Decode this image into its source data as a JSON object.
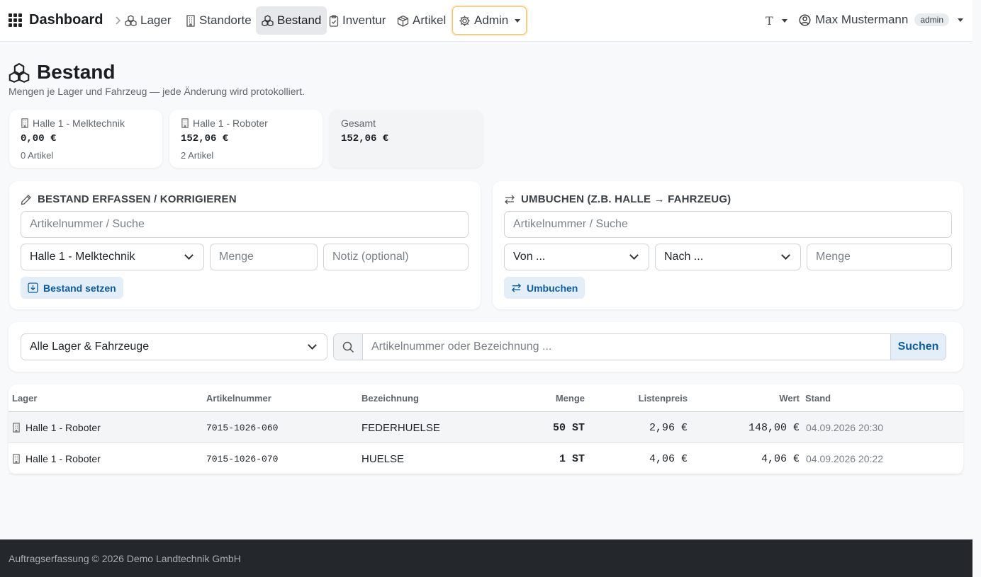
{
  "nav": {
    "brand": "Dashboard",
    "items": [
      {
        "label": "Lager",
        "icon": "boxes-icon"
      },
      {
        "label": "Standorte",
        "icon": "building-icon"
      },
      {
        "label": "Bestand",
        "icon": "boxes-icon",
        "active": true
      },
      {
        "label": "Inventur",
        "icon": "clipboard-check-icon"
      },
      {
        "label": "Artikel",
        "icon": "box-icon"
      },
      {
        "label": "Admin",
        "icon": "gear-icon"
      }
    ],
    "theme_label": "T",
    "user_name": "Max Mustermann",
    "user_role": "admin"
  },
  "page": {
    "title": "Bestand",
    "subtitle": "Mengen je Lager und Fahrzeug — jede Änderung wird protokolliert."
  },
  "summary": [
    {
      "name": "Halle 1 - Melktechnik",
      "value": "0,00 €",
      "count": "0 Artikel"
    },
    {
      "name": "Halle 1 - Roboter",
      "value": "152,06 €",
      "count": "2 Artikel"
    },
    {
      "name": "Gesamt",
      "value": "152,06 €"
    }
  ],
  "stock_form": {
    "title": "BESTAND ERFASSEN / KORRIGIEREN",
    "article_placeholder": "Artikelnummer / Suche",
    "location_value": "Halle 1 - Melktechnik",
    "qty_placeholder": "Menge",
    "note_placeholder": "Notiz (optional)",
    "submit_label": "Bestand setzen"
  },
  "transfer_form": {
    "title": "UMBUCHEN (Z.B. HALLE → FAHRZEUG)",
    "article_placeholder": "Artikelnummer / Suche",
    "from_value": "Von ...",
    "to_value": "Nach ...",
    "qty_placeholder": "Menge",
    "submit_label": "Umbuchen"
  },
  "filter": {
    "location_value": "Alle Lager & Fahrzeuge",
    "search_placeholder": "Artikelnummer oder Bezeichnung ...",
    "search_label": "Suchen"
  },
  "table": {
    "headers": {
      "lager": "Lager",
      "artnr": "Artikelnummer",
      "bez": "Bezeichnung",
      "menge": "Menge",
      "preis": "Listenpreis",
      "wert": "Wert",
      "stand": "Stand"
    },
    "rows": [
      {
        "lager": "Halle 1 - Roboter",
        "artnr": "7015-1026-060",
        "bez": "FEDERHUELSE",
        "menge": "50 ST",
        "preis": "2,96 €",
        "wert": "148,00 €",
        "stand": "04.09.2026 20:30"
      },
      {
        "lager": "Halle 1 - Roboter",
        "artnr": "7015-1026-070",
        "bez": "HUELSE",
        "menge": "1 ST",
        "preis": "4,06 €",
        "wert": "4,06 €",
        "stand": "04.09.2026 20:22"
      }
    ]
  },
  "footer": {
    "text": "Auftragserfassung © 2026 Demo Landtechnik GmbH"
  }
}
